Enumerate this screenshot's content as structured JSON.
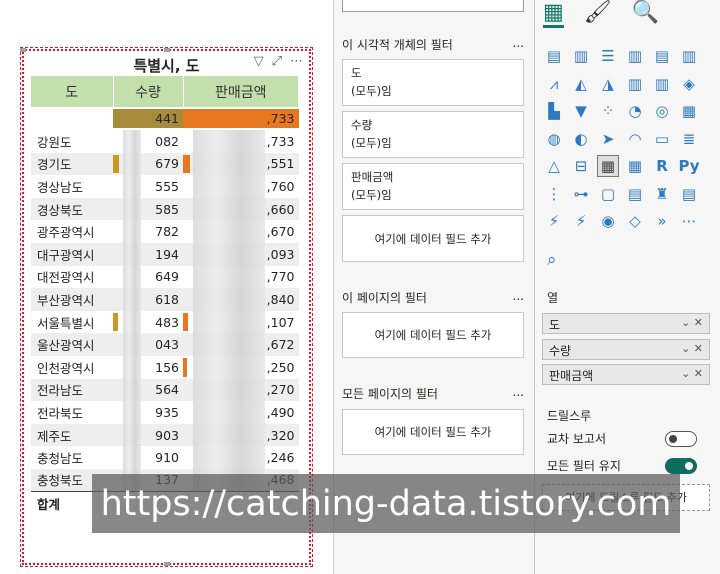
{
  "visual": {
    "title": "특별시, 도",
    "headers": [
      "도",
      "수량",
      "판매금액"
    ],
    "blank_row": {
      "qty": "441",
      "sales": ",733"
    },
    "rows": [
      {
        "name": "강원도",
        "qty": "082",
        "sales": ",733"
      },
      {
        "name": "경기도",
        "qty": "679",
        "sales": ",551"
      },
      {
        "name": "경상남도",
        "qty": "555",
        "sales": ",760"
      },
      {
        "name": "경상북도",
        "qty": "585",
        "sales": ",660"
      },
      {
        "name": "광주광역시",
        "qty": "782",
        "sales": ",670"
      },
      {
        "name": "대구광역시",
        "qty": "194",
        "sales": ",093"
      },
      {
        "name": "대전광역시",
        "qty": "649",
        "sales": ",770"
      },
      {
        "name": "부산광역시",
        "qty": "618",
        "sales": ",840"
      },
      {
        "name": "서울특별시",
        "qty": "483",
        "sales": ",107"
      },
      {
        "name": "울산광역시",
        "qty": "043",
        "sales": ",672"
      },
      {
        "name": "인천광역시",
        "qty": "156",
        "sales": ",250"
      },
      {
        "name": "전라남도",
        "qty": "564",
        "sales": ",270"
      },
      {
        "name": "전라북도",
        "qty": "935",
        "sales": ",490"
      },
      {
        "name": "제주도",
        "qty": "903",
        "sales": ",320"
      },
      {
        "name": "충청남도",
        "qty": "910",
        "sales": ",246"
      },
      {
        "name": "충청북도",
        "qty": "137",
        "sales": ",468"
      }
    ],
    "total_label": "합계",
    "icons": [
      "filter-icon",
      "focus-mode-icon",
      "more-options-icon"
    ]
  },
  "filters": {
    "visual_section": "이 시각적 개체의 필터",
    "cards": [
      {
        "field": "도",
        "state": "(모두)임"
      },
      {
        "field": "수량",
        "state": "(모두)임"
      },
      {
        "field": "판매금액",
        "state": "(모두)임"
      }
    ],
    "add_field": "여기에 데이터 필드 추가",
    "page_section": "이 페이지의 필터",
    "all_pages_section": "모든 페이지의 필터",
    "more": "..."
  },
  "viz_pane": {
    "columns_label": "열",
    "wells": [
      "도",
      "수량",
      "판매금액"
    ],
    "drillthrough_label": "드릴스루",
    "cross_report_label": "교차 보고서",
    "keep_filters_label": "모든 필터 유지",
    "cross_report_on": false,
    "keep_filters_on": true,
    "drill_add": "여기에 드릴스루 필드 추가"
  },
  "watermark": "https://catching-data.tistory.com",
  "colors": {
    "header_green": "#c3dfac",
    "qty_bar": "#c89a24",
    "sales_bar": "#e87722",
    "accent": "#117865"
  }
}
